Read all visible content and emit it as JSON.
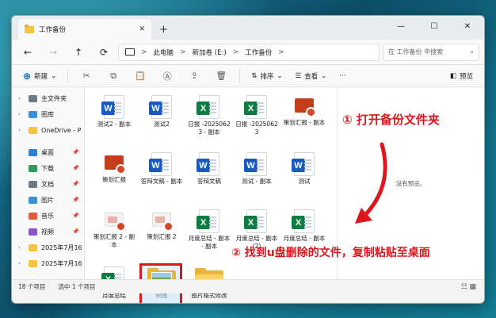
{
  "window": {
    "tab_title": "工作备份",
    "controls": {
      "minimize": "—",
      "maximize": "☐",
      "close": "✕"
    }
  },
  "address": {
    "crumbs": [
      "此电脑",
      "新加卷 (E:)",
      "工作备份"
    ],
    "separator": ">",
    "search_placeholder": "在 工作备份 中搜索"
  },
  "toolbar": {
    "new_label": "新建",
    "sort_label": "排序",
    "view_label": "查看",
    "more_label": "···",
    "preview_label": "预览"
  },
  "sidebar": {
    "items": [
      {
        "label": "主文件夹",
        "icon": "home-icon"
      },
      {
        "label": "图库",
        "icon": "gallery-icon"
      },
      {
        "label": "OneDrive - P",
        "icon": "onedrive-icon"
      },
      {
        "label": "桌面",
        "icon": "desktop-icon"
      },
      {
        "label": "下载",
        "icon": "download-icon"
      },
      {
        "label": "文档",
        "icon": "documents-icon"
      },
      {
        "label": "图片",
        "icon": "pictures-icon"
      },
      {
        "label": "音乐",
        "icon": "music-icon"
      },
      {
        "label": "视频",
        "icon": "videos-icon"
      },
      {
        "label": "2025年7月16",
        "icon": "folder-icon"
      },
      {
        "label": "2025年7月16",
        "icon": "folder-icon"
      }
    ]
  },
  "files": [
    {
      "name": "测试2 - 副本",
      "type": "word"
    },
    {
      "name": "测试2",
      "type": "word"
    },
    {
      "name": "日报 -2025062 3 - 副本",
      "type": "excel"
    },
    {
      "name": "日报 -2025062 3",
      "type": "excel"
    },
    {
      "name": "策划汇报 - 副本",
      "type": "ppt"
    },
    {
      "name": "策划汇报",
      "type": "ppt"
    },
    {
      "name": "答辩文稿 - 副本",
      "type": "word"
    },
    {
      "name": "答辩文稿",
      "type": "word"
    },
    {
      "name": "测试 - 副本",
      "type": "word"
    },
    {
      "name": "测试",
      "type": "word"
    },
    {
      "name": "策划汇报 2 - 副本",
      "type": "ppt-light"
    },
    {
      "name": "策划汇报 2",
      "type": "ppt-light"
    },
    {
      "name": "月度总结 - 副本 - 副本",
      "type": "excel"
    },
    {
      "name": "月度总结 - 副本 (2)",
      "type": "excel"
    },
    {
      "name": "月度总结 - 副本",
      "type": "excel"
    },
    {
      "name": "月度总结",
      "type": "excel"
    },
    {
      "name": "例图",
      "type": "image-folder",
      "selected": true
    },
    {
      "name": "图片格式修改",
      "type": "folder"
    }
  ],
  "preview_pane": {
    "text": "没有预览。"
  },
  "status": {
    "count": "18 个项目",
    "selected": "选中 1 个项目"
  },
  "annotations": {
    "step1": "① 打开备份文件夹",
    "step2": "② 找到u盘删除的文件，复制粘贴至桌面"
  },
  "colors": {
    "annotation": "#e0141b",
    "word": "#185abd",
    "excel": "#107c41",
    "ppt": "#c43e1c"
  }
}
